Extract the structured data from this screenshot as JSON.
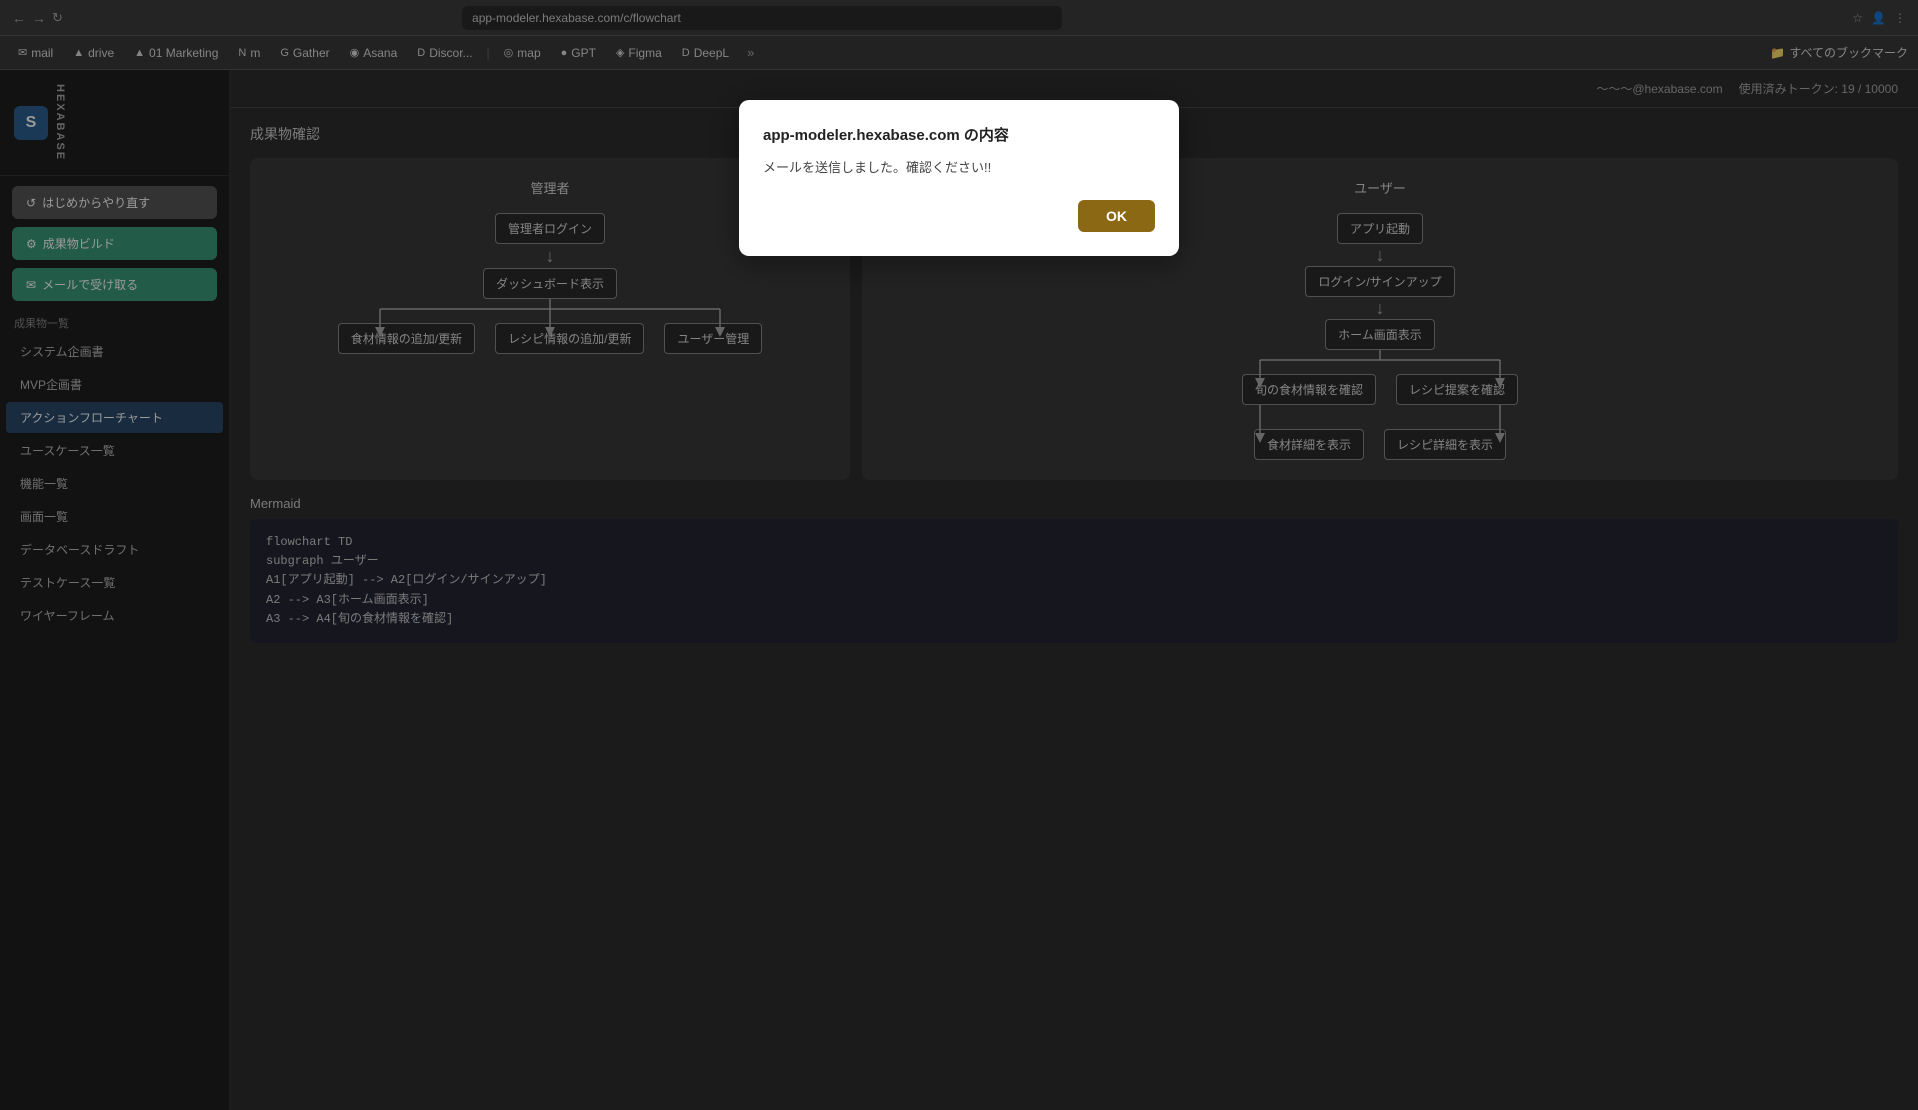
{
  "browser": {
    "url": "app-modeler.hexabase.com/c/flowchart",
    "nav": {
      "back": "←",
      "forward": "→",
      "refresh": "↻"
    },
    "bookmarks": [
      {
        "label": "mail",
        "icon": "✉"
      },
      {
        "label": "drive",
        "icon": "▲"
      },
      {
        "label": "01 Marketing",
        "icon": "▲"
      },
      {
        "label": "m",
        "icon": "N"
      },
      {
        "label": "Gather",
        "icon": "G"
      },
      {
        "label": "Asana",
        "icon": "◉"
      },
      {
        "label": "Discor...",
        "icon": "D"
      },
      {
        "label": "map",
        "icon": "◎"
      },
      {
        "label": "GPT",
        "icon": "●"
      },
      {
        "label": "Figma",
        "icon": "◈"
      },
      {
        "label": "DeepL",
        "icon": "D"
      }
    ],
    "bookmarks_folder": "すべてのブックマーク"
  },
  "header": {
    "user_email": "～～～@hexabase.com",
    "token_label": "使用済みトークン: 19 / 10000"
  },
  "sidebar": {
    "logo_text": "HEXABASE",
    "reset_button": "はじめからやり直す",
    "build_button": "成果物ビルド",
    "mail_button": "メールで受け取る",
    "section_title": "成果物一覧",
    "nav_items": [
      {
        "label": "システム企画書",
        "active": false
      },
      {
        "label": "MVP企画書",
        "active": false
      },
      {
        "label": "アクションフローチャート",
        "active": true
      },
      {
        "label": "ユースケース一覧",
        "active": false
      },
      {
        "label": "機能一覧",
        "active": false
      },
      {
        "label": "画面一覧",
        "active": false
      },
      {
        "label": "データベースドラフト",
        "active": false
      },
      {
        "label": "テストケース一覧",
        "active": false
      },
      {
        "label": "ワイヤーフレーム",
        "active": false
      }
    ]
  },
  "content": {
    "title": "成果物確認",
    "admin_chart": {
      "title": "管理者",
      "nodes": {
        "login": "管理者ログイン",
        "dashboard": "ダッシュボード表示",
        "food_add": "食材情報の追加/更新",
        "recipe_add": "レシピ情報の追加/更新",
        "user_mgmt": "ユーザー管理"
      }
    },
    "user_chart": {
      "title": "ユーザー",
      "nodes": {
        "app_start": "アプリ起動",
        "login": "ログイン/サインアップ",
        "home": "ホーム画面表示",
        "food_check": "旬の食材情報を確認",
        "recipe_check": "レシピ提案を確認",
        "food_detail": "食材詳細を表示",
        "recipe_detail": "レシピ詳細を表示"
      }
    },
    "mermaid": {
      "title": "Mermaid",
      "code": [
        "flowchart TD",
        "    subgraph ユーザー",
        "        A1[アプリ起動] --> A2[ログイン/サインアップ]",
        "        A2 --> A3[ホーム画面表示]",
        "        A3 --> A4[旬の食材情報を確認]"
      ]
    }
  },
  "modal": {
    "title": "app-modeler.hexabase.com の内容",
    "message": "メールを送信しました。確認ください!!",
    "ok_label": "OK"
  }
}
